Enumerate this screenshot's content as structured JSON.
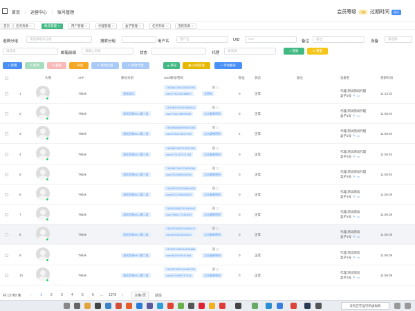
{
  "header": {
    "breadcrumbs": [
      "首页",
      "/",
      "运营中心",
      "/",
      "账号管理"
    ],
    "member_label": "会员等级",
    "member_badge": "vip",
    "expire_label": "过期时间",
    "days_badge": "永久"
  },
  "tabs": [
    "首页",
    "任务资源",
    "账号管理",
    "用户管理",
    "代理管理",
    "盒子管理",
    "任务列表",
    "活跃资源"
  ],
  "filters": {
    "group_label": "选择分组",
    "group_placeholder": "请选择账号分组",
    "search_group_label": "搜索分组",
    "username_label": "用户名",
    "username_placeholder": "用户名",
    "uid_label": "UID",
    "uid_placeholder": "UID",
    "remark_label": "备注",
    "remark_placeholder": "备注",
    "device_label": "设备",
    "device_placeholder": "请选择",
    "placeholder2": "请选择",
    "mailbox_label": "邮箱前缀",
    "mailbox_placeholder": "请输入后缀",
    "status_label": "状态",
    "proxy_label": "代理",
    "proxy_placeholder": "请选择",
    "search_btn": "搜索",
    "reset_btn": "重置"
  },
  "toolbar": [
    "新增",
    "修改",
    "删除",
    "导出",
    "修改分组",
    "修改代理",
    "养号",
    "分组管理",
    "手动备份"
  ],
  "table": {
    "columns": [
      "头像",
      "APP",
      "账号分组",
      "UID/账号/密码",
      "粉丝",
      "状态",
      "备注",
      "设备名",
      "更新时间"
    ],
    "rows": [
      {
        "no": "1",
        "app": "Tiktok",
        "group": "测试测试",
        "uid": "7402641460438162094",
        "account": "user2740149288867",
        "pw": "无密码",
        "fans": "0",
        "status": "正常",
        "device_line1": "代理:测试测试代理",
        "device_line2": "盒子1号",
        "time": "11:13:32"
      },
      {
        "no": "2",
        "app": "Tiktok",
        "group": "测试资源0813第三批",
        "uid": "7402599751061060014",
        "account": "user7161135895406",
        "pw": "点击复制密码",
        "fans": "0",
        "status": "正常",
        "device_line1": "代理:测试测试代理",
        "device_line2": "盒子1号",
        "time": "11:06:40"
      },
      {
        "no": "3",
        "app": "Tiktok",
        "group": "测试资源0813第三批",
        "uid": "7402588848959025184",
        "account": "user2330478627058",
        "pw": "点击复制密码",
        "fans": "2",
        "status": "正常",
        "device_line1": "代理:测试测试代理",
        "device_line2": "盒子1号",
        "time": "11:06:40"
      },
      {
        "no": "4",
        "app": "Tiktok",
        "group": "测试资源0813第三批",
        "uid": "7402587843379512362",
        "account": "user5731187321258",
        "pw": "点击复制密码",
        "fans": "0",
        "status": "正常",
        "device_line1": "代理:测试测试代理",
        "device_line2": "盒子1号",
        "time": "11:06:40"
      },
      {
        "no": "5",
        "app": "Tiktok",
        "group": "测试资源0813第三批",
        "uid": "7402587345176026284",
        "account": "user2303469030356",
        "pw": "点击复制密码",
        "fans": "0",
        "status": "正常",
        "device_line1": "代理:测试测试代理",
        "device_line2": "盒子1号",
        "time": "11:06:40"
      },
      {
        "no": "6",
        "app": "Tiktok",
        "group": "测试资源0813第二批",
        "uid": "7402578707608810539",
        "account": "user6321399849493",
        "pw": "点击复制密码",
        "fans": "0",
        "status": "正常",
        "device_line1": "代理:测试测试",
        "device_line2": "盒子1号",
        "time": "11:06:39"
      },
      {
        "no": "7",
        "app": "Tiktok",
        "group": "测试资源0813第二批",
        "uid": "7402578532267546542",
        "account": "user7586177281559",
        "pw": "点击复制密码",
        "fans": "0",
        "status": "正常",
        "device_line1": "代理:测试测试",
        "device_line2": "盒子1号",
        "time": "11:06:39"
      },
      {
        "no": "8",
        "app": "Tiktok",
        "group": "测试资源0813第二批",
        "uid": "7402578006332098474",
        "account": "user6819823819640",
        "pw": "点击复制密码",
        "fans": "0",
        "status": "正常",
        "device_line1": "代理:测试测试",
        "device_line2": "盒子1号",
        "time": "11:06:39"
      },
      {
        "no": "9",
        "app": "Tiktok",
        "group": "测试资源0813第二批",
        "uid": "7402574083251875886",
        "account": "user5819349411864",
        "pw": "点击复制密码",
        "fans": "0",
        "status": "正常",
        "device_line1": "代理:测试测试",
        "device_line2": "盒子1号",
        "time": "11:06:39"
      },
      {
        "no": "10",
        "app": "Tiktok",
        "group": "测试资源0813第二批",
        "uid": "7402573057949482234",
        "account": "user6124959757936",
        "pw": "点击复制密码",
        "fans": "0",
        "status": "正常",
        "device_line1": "代理:测试测试",
        "device_line2": "盒子1号",
        "time": "11:06:39"
      }
    ]
  },
  "pagination": {
    "total": "共 13780 条",
    "pages": [
      "1",
      "2",
      "3",
      "4",
      "5",
      "6",
      "...",
      "1378"
    ],
    "page_size": "10条/页",
    "goto": "前往"
  },
  "taskbar": {
    "notice": "没有正在运行的虚拟机"
  },
  "colors": {
    "primary": "#4a8ff5",
    "success": "#42b983",
    "warning": "#f5a623",
    "danger": "#f56c6c"
  }
}
